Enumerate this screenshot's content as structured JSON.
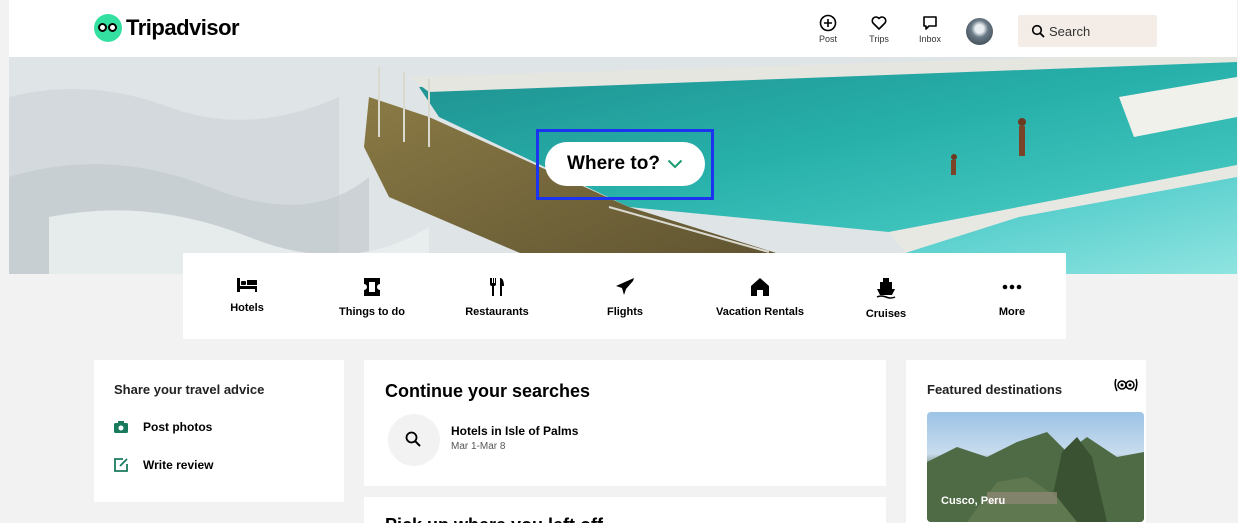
{
  "header": {
    "brand": "Tripadvisor",
    "nav": [
      {
        "label": "Post",
        "icon": "plus-circle-icon"
      },
      {
        "label": "Trips",
        "icon": "heart-icon"
      },
      {
        "label": "Inbox",
        "icon": "message-icon"
      }
    ],
    "search_placeholder": "Search"
  },
  "hero": {
    "where_to": "Where to?"
  },
  "categories": [
    {
      "label": "Hotels",
      "icon": "bed-icon"
    },
    {
      "label": "Things to do",
      "icon": "ticket-icon"
    },
    {
      "label": "Restaurants",
      "icon": "fork-knife-icon"
    },
    {
      "label": "Flights",
      "icon": "plane-icon"
    },
    {
      "label": "Vacation Rentals",
      "icon": "house-icon"
    },
    {
      "label": "Cruises",
      "icon": "ship-icon"
    },
    {
      "label": "More",
      "icon": "more-dots-icon"
    }
  ],
  "share": {
    "title": "Share your travel advice",
    "post_photos": "Post photos",
    "write_review": "Write review"
  },
  "continue": {
    "title": "Continue your searches",
    "item_title": "Hotels in Isle of Palms",
    "item_dates": "Mar 1-Mar 8"
  },
  "continue2": {
    "title": "Pick up where you left off"
  },
  "featured": {
    "title": "Featured destinations",
    "caption": "Cusco, Peru"
  },
  "colors": {
    "brand_green": "#34e0a1",
    "highlight_blue": "#1c33f0",
    "icon_green": "#1a7a5e"
  }
}
